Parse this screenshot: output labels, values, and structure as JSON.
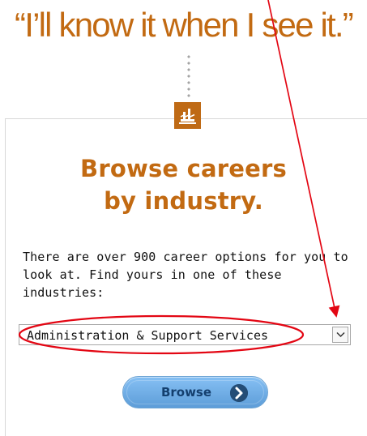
{
  "header": {
    "quote": "“I’ll know it when I see it.”"
  },
  "section": {
    "icon": "factory-icon",
    "title_line_1": "Browse careers",
    "title_line_2": "by industry.",
    "description": "There are over 900 career options for you to look at. Find yours in one of these industries:"
  },
  "industry_select": {
    "selected_value": "Administration & Support Services",
    "arrow_icon": "chevron-down-icon"
  },
  "actions": {
    "browse_label": "Browse",
    "browse_icon": "arrow-right-circle-icon"
  },
  "annotations": {
    "highlight_color": "#e30613",
    "arrow_color": "#e30613",
    "circle_icon": "red-ellipse-annotation",
    "arrow_icon": "red-arrow-annotation"
  },
  "colors": {
    "brand_orange": "#c26a12",
    "button_blue": "#6eb2ee",
    "button_text": "#143f6e",
    "border_gray": "#a7a7a7"
  }
}
